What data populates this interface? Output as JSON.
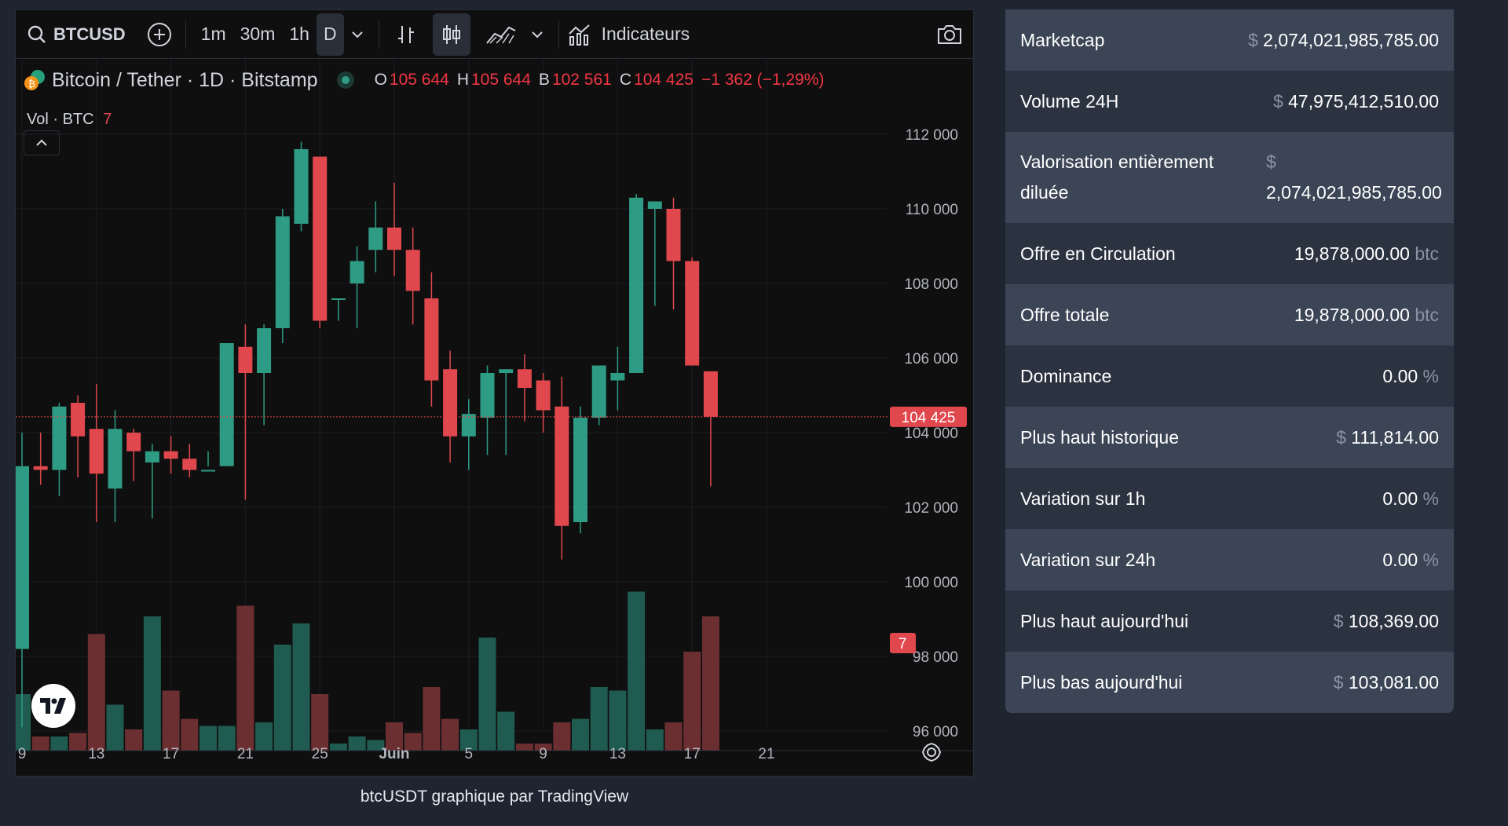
{
  "toolbar": {
    "symbol": "BTCUSD",
    "intervals": [
      "1m",
      "30m",
      "1h",
      "D"
    ],
    "active_interval": "D",
    "indicators_label": "Indicateurs"
  },
  "legend": {
    "title": "Bitcoin / Tether · 1D · Bitstamp",
    "o_label": "O",
    "o_value": "105 644",
    "h_label": "H",
    "h_value": "105 644",
    "b_label": "B",
    "b_value": "102 561",
    "c_label": "C",
    "c_value": "104 425",
    "change": "−1 362 (−1,29%)",
    "volume_label": "Vol · BTC",
    "volume_value": "7"
  },
  "caption": "btcUSDT graphique par TradingView",
  "colors": {
    "up": "#2e9c85",
    "down": "#e0484e",
    "up_vol": "#1f5b50",
    "down_vol": "#6b2f31"
  },
  "chart_data": {
    "type": "candlestick",
    "y_ticks": [
      "112 000",
      "110 000",
      "108 000",
      "106 000",
      "104 000",
      "102 000",
      "100 000",
      "98 000",
      "96 000"
    ],
    "y_tick_values": [
      112000,
      110000,
      108000,
      106000,
      104000,
      102000,
      100000,
      98000,
      96000
    ],
    "x_ticks": [
      "9",
      "13",
      "17",
      "21",
      "25",
      "Juin",
      "5",
      "9",
      "13",
      "17",
      "21"
    ],
    "x_tick_day_index": [
      0,
      4,
      8,
      12,
      16,
      20,
      24,
      28,
      32,
      36,
      40
    ],
    "last_price_label": "104 425",
    "last_price": 104425,
    "volume_badge": "7",
    "candles": [
      {
        "o": 98200,
        "h": 104000,
        "l": 96100,
        "c": 103100
      },
      {
        "o": 103100,
        "h": 104000,
        "l": 102600,
        "c": 103000
      },
      {
        "o": 103000,
        "h": 104800,
        "l": 102300,
        "c": 104700
      },
      {
        "o": 104800,
        "h": 105000,
        "l": 102800,
        "c": 103900
      },
      {
        "o": 104100,
        "h": 105300,
        "l": 101600,
        "c": 102900
      },
      {
        "o": 102500,
        "h": 104600,
        "l": 101600,
        "c": 104100
      },
      {
        "o": 104000,
        "h": 104100,
        "l": 102700,
        "c": 103500
      },
      {
        "o": 103200,
        "h": 103700,
        "l": 101700,
        "c": 103500
      },
      {
        "o": 103500,
        "h": 103900,
        "l": 102900,
        "c": 103300
      },
      {
        "o": 103300,
        "h": 103700,
        "l": 102800,
        "c": 103000
      },
      {
        "o": 103000,
        "h": 103500,
        "l": 103100,
        "c": 103000
      },
      {
        "o": 103100,
        "h": 106400,
        "l": 103100,
        "c": 106400
      },
      {
        "o": 106300,
        "h": 106900,
        "l": 102200,
        "c": 105600
      },
      {
        "o": 105600,
        "h": 106900,
        "l": 104200,
        "c": 106800
      },
      {
        "o": 106800,
        "h": 110000,
        "l": 106400,
        "c": 109800
      },
      {
        "o": 109600,
        "h": 111800,
        "l": 109400,
        "c": 111600
      },
      {
        "o": 111400,
        "h": 111400,
        "l": 106800,
        "c": 107000
      },
      {
        "o": 107600,
        "h": 107600,
        "l": 107000,
        "c": 107600
      },
      {
        "o": 108000,
        "h": 109000,
        "l": 106800,
        "c": 108600
      },
      {
        "o": 108900,
        "h": 110200,
        "l": 108300,
        "c": 109500
      },
      {
        "o": 109500,
        "h": 110700,
        "l": 108200,
        "c": 108900
      },
      {
        "o": 108900,
        "h": 109500,
        "l": 106900,
        "c": 107800
      },
      {
        "o": 107600,
        "h": 108300,
        "l": 104700,
        "c": 105400
      },
      {
        "o": 105700,
        "h": 106200,
        "l": 103200,
        "c": 103900
      },
      {
        "o": 103900,
        "h": 104900,
        "l": 103000,
        "c": 104500
      },
      {
        "o": 104400,
        "h": 105800,
        "l": 103400,
        "c": 105600
      },
      {
        "o": 105600,
        "h": 105700,
        "l": 103400,
        "c": 105700
      },
      {
        "o": 105700,
        "h": 106100,
        "l": 104300,
        "c": 105200
      },
      {
        "o": 105400,
        "h": 105600,
        "l": 104000,
        "c": 104600
      },
      {
        "o": 104700,
        "h": 105500,
        "l": 100600,
        "c": 101500
      },
      {
        "o": 101600,
        "h": 104700,
        "l": 101300,
        "c": 104400
      },
      {
        "o": 104400,
        "h": 105800,
        "l": 104200,
        "c": 105800
      },
      {
        "o": 105400,
        "h": 106300,
        "l": 104600,
        "c": 105600
      },
      {
        "o": 105600,
        "h": 110400,
        "l": 105600,
        "c": 110300
      },
      {
        "o": 110000,
        "h": 110200,
        "l": 107400,
        "c": 110200
      },
      {
        "o": 110000,
        "h": 110300,
        "l": 107300,
        "c": 108600
      },
      {
        "o": 108600,
        "h": 108700,
        "l": 105800,
        "c": 105800
      },
      {
        "o": 105644,
        "h": 105644,
        "l": 102561,
        "c": 104425
      }
    ],
    "volumes": [
      1.6,
      0.4,
      0.4,
      0.5,
      3.3,
      1.3,
      0.6,
      3.8,
      1.7,
      0.9,
      0.7,
      0.7,
      4.1,
      0.8,
      3.0,
      3.6,
      1.6,
      0.2,
      0.4,
      0.3,
      0.8,
      0.5,
      1.8,
      0.9,
      0.6,
      3.2,
      1.1,
      0.2,
      0.2,
      0.8,
      0.9,
      1.8,
      1.7,
      4.5,
      0.6,
      0.8,
      2.8,
      3.8
    ]
  },
  "stats": [
    {
      "label": "Marketcap",
      "prefix": "$",
      "value": "2,074,021,985,785.00",
      "suffix": ""
    },
    {
      "label": "Volume 24H",
      "prefix": "$",
      "value": "47,975,412,510.00",
      "suffix": ""
    },
    {
      "label": "Valorisation entièrement diluée",
      "prefix": "$",
      "value": "2,074,021,985,785.00",
      "suffix": ""
    },
    {
      "label": "Offre en Circulation",
      "prefix": "",
      "value": "19,878,000.00",
      "suffix": "btc"
    },
    {
      "label": "Offre totale",
      "prefix": "",
      "value": "19,878,000.00",
      "suffix": "btc"
    },
    {
      "label": "Dominance",
      "prefix": "",
      "value": "0.00",
      "suffix": "%"
    },
    {
      "label": "Plus haut historique",
      "prefix": "$",
      "value": "111,814.00",
      "suffix": ""
    },
    {
      "label": "Variation sur 1h",
      "prefix": "",
      "value": "0.00",
      "suffix": "%"
    },
    {
      "label": "Variation sur 24h",
      "prefix": "",
      "value": "0.00",
      "suffix": "%"
    },
    {
      "label": "Plus haut aujourd'hui",
      "prefix": "$",
      "value": "108,369.00",
      "suffix": ""
    },
    {
      "label": "Plus bas aujourd'hui",
      "prefix": "$",
      "value": "103,081.00",
      "suffix": ""
    }
  ]
}
